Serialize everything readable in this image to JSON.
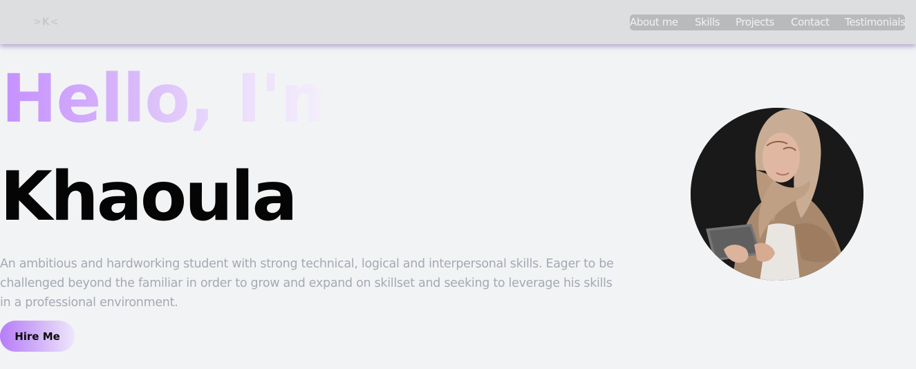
{
  "header": {
    "logo": ">K<",
    "nav": [
      {
        "label": "About me"
      },
      {
        "label": "Skills"
      },
      {
        "label": "Projects"
      },
      {
        "label": "Contact"
      },
      {
        "label": "Testimonials"
      }
    ]
  },
  "hero": {
    "greeting": "Hello, I'm",
    "name": "Khaoula",
    "bio": "An ambitious and hardworking student with strong technical, logical and interpersonal skills. Eager to be challenged beyond the familiar in order to grow and expand on skillset and seeking to leverage his skills in a professional environment.",
    "cta_label": "Hire Me"
  },
  "colors": {
    "accent": "#c590ff",
    "page_background": "#f2f3f5",
    "header_background": "#dddee0",
    "bio_text": "#a3a9b3"
  },
  "icons": {
    "avatar": "profile-photo"
  }
}
